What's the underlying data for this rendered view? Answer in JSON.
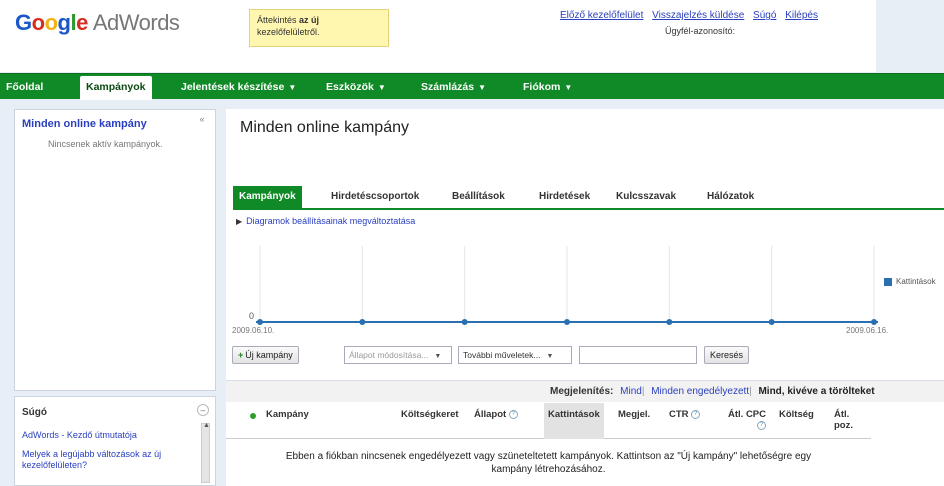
{
  "header": {
    "logo_google": [
      "G",
      "o",
      "o",
      "g",
      "l",
      "e"
    ],
    "logo_product": "AdWords",
    "notice_line1": "Áttekintés",
    "notice_bold": "az új",
    "notice_line2": "kezelőfelületről.",
    "links": [
      "Előző kezelőfelület",
      "Visszajelzés küldése",
      "Súgó",
      "Kilépés"
    ],
    "customer_id_label": "Ügyfél-azonosító:"
  },
  "nav": {
    "items": [
      {
        "label": "Főoldal",
        "caret": false
      },
      {
        "label": "Kampányok",
        "caret": false,
        "active": true
      },
      {
        "label": "Jelentések készítése",
        "caret": true
      },
      {
        "label": "Eszközök",
        "caret": true
      },
      {
        "label": "Számlázás",
        "caret": true
      },
      {
        "label": "Fiókom",
        "caret": true
      }
    ]
  },
  "sidebar": {
    "title": "Minden online kampány",
    "collapse": "«",
    "empty": "Nincsenek aktív kampányok."
  },
  "help": {
    "title": "Súgó",
    "minus": "–",
    "links": [
      "AdWords - Kezdő útmutatója",
      "Melyek a legújabb változások az új kezelőfelületen?"
    ]
  },
  "main": {
    "title": "Minden online kampány",
    "tabs": [
      "Kampányok",
      "Hirdetéscsoportok",
      "Beállítások",
      "Hirdetések",
      "Kulcsszavak",
      "Hálózatok"
    ],
    "chart_link": "Diagramok beállításainak megváltoztatása",
    "toolbar": {
      "new_campaign": "Új kampány",
      "status_select": "Állapot módosítása...",
      "more_actions": "További műveletek...",
      "search_button": "Keresés"
    },
    "display": {
      "label": "Megjelenítés:",
      "options": [
        "Mind",
        "Minden engedélyezett"
      ],
      "current": "Mind, kivéve a törölteket"
    },
    "columns": [
      "Kampány",
      "Költségkeret",
      "Állapot",
      "Kattintások",
      "Megjel.",
      "CTR",
      "Átl. CPC",
      "Költség",
      "Átl. poz."
    ],
    "empty_message_line1": "Ebben a fiókban nincsenek engedélyezett vagy szüneteltetett kampányok. Kattintson az \"Új kampány\" lehetőségre egy",
    "empty_message_line2": "kampány létrehozásához."
  },
  "chart_data": {
    "type": "line",
    "x": [
      "2009.06.10.",
      "2009.06.11.",
      "2009.06.12.",
      "2009.06.13.",
      "2009.06.14.",
      "2009.06.15.",
      "2009.06.16."
    ],
    "series": [
      {
        "name": "Kattintások",
        "values": [
          0,
          0,
          0,
          0,
          0,
          0,
          0
        ]
      }
    ],
    "y_tick_label": "0",
    "x_tick_labels": [
      "2009.06.10.",
      "2009.06.16."
    ],
    "legend_placement": "right",
    "grid": true,
    "color": "#2a6fb0"
  },
  "colors": {
    "nav_green": "#108a26",
    "link_blue": "#2a3fbd",
    "notice_yellow": "#fff6b0"
  }
}
